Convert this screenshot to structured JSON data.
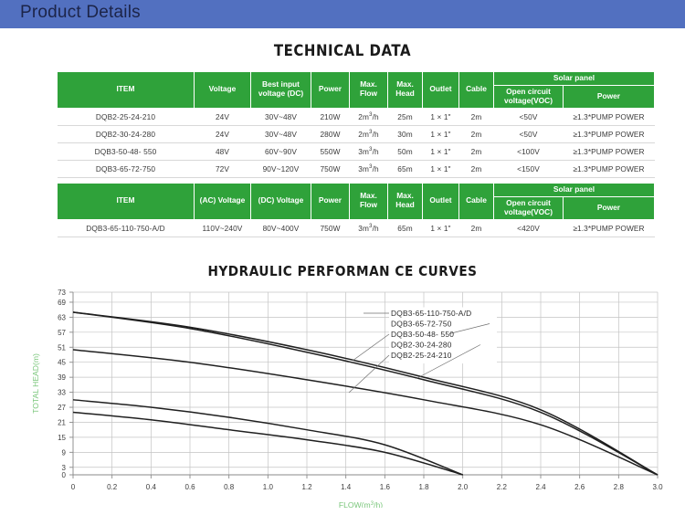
{
  "header": {
    "title": "Product Details",
    "bg_color": "#5270c0",
    "text_color": "#1c2448"
  },
  "theme": {
    "table_header_green": "#2fa23a",
    "axis_label_green": "#79c67a",
    "curve_color": "#1f1f1f",
    "grid_color": "#c4c4c4"
  },
  "tech_data": {
    "title": "TECHNICAL DATA",
    "table_main": {
      "group_header": "Solar panel",
      "columns": [
        "ITEM",
        "Voltage",
        "Best input voltage (DC)",
        "Power",
        "Max. Flow",
        "Max. Head",
        "Outlet",
        "Cable",
        "Open circuit voltage(VOC)",
        "Power"
      ],
      "columns_split": {
        "best_input_line1": "Best input",
        "best_input_line2": "voltage (DC)",
        "max_flow_line1": "Max.",
        "max_flow_line2": "Flow",
        "max_head_line1": "Max.",
        "max_head_line2": "Head",
        "voc_line1": "Open circuit",
        "voc_line2": "voltage(VOC)"
      },
      "rows": [
        {
          "item": "DQB2-25-24-210",
          "voltage": "24V",
          "best_input_voltage": "30V~48V",
          "power": "210W",
          "max_flow_num": "2m",
          "max_flow_sup": "3",
          "max_flow_unit": "/h",
          "max_head": "25m",
          "outlet": "1 × 1\"",
          "cable": "2m",
          "voc": "<50V",
          "solar_power": "≥1.3*PUMP POWER"
        },
        {
          "item": "DQB2-30-24-280",
          "voltage": "24V",
          "best_input_voltage": "30V~48V",
          "power": "280W",
          "max_flow_num": "2m",
          "max_flow_sup": "3",
          "max_flow_unit": "/h",
          "max_head": "30m",
          "outlet": "1 × 1\"",
          "cable": "2m",
          "voc": "<50V",
          "solar_power": "≥1.3*PUMP POWER"
        },
        {
          "item": "DQB3-50-48- 550",
          "voltage": "48V",
          "best_input_voltage": "60V~90V",
          "power": "550W",
          "max_flow_num": "3m",
          "max_flow_sup": "3",
          "max_flow_unit": "/h",
          "max_head": "50m",
          "outlet": "1 × 1\"",
          "cable": "2m",
          "voc": "<100V",
          "solar_power": "≥1.3*PUMP POWER"
        },
        {
          "item": "DQB3-65-72-750",
          "voltage": "72V",
          "best_input_voltage": "90V~120V",
          "power": "750W",
          "max_flow_num": "3m",
          "max_flow_sup": "3",
          "max_flow_unit": "/h",
          "max_head": "65m",
          "outlet": "1 × 1\"",
          "cable": "2m",
          "voc": "<150V",
          "solar_power": "≥1.3*PUMP POWER"
        }
      ]
    },
    "table_ac": {
      "group_header": "Solar panel",
      "columns": [
        "ITEM",
        "(AC) Voltage",
        "(DC) Voltage",
        "Power",
        "Max. Flow",
        "Max. Head",
        "Outlet",
        "Cable",
        "Open circuit voltage(VOC)",
        "Power"
      ],
      "columns_split": {
        "ac_voltage": "(AC) Voltage",
        "dc_voltage": "(DC) Voltage",
        "max_flow_line1": "Max.",
        "max_flow_line2": "Flow",
        "max_head_line1": "Max.",
        "max_head_line2": "Head",
        "voc_line1": "Open circuit",
        "voc_line2": "voltage(VOC)"
      },
      "rows": [
        {
          "item": "DQB3-65-110-750-A/D",
          "ac_voltage": "110V~240V",
          "dc_voltage": "80V~400V",
          "power": "750W",
          "max_flow_num": "3m",
          "max_flow_sup": "3",
          "max_flow_unit": "/h",
          "max_head": "65m",
          "outlet": "1 × 1\"",
          "cable": "2m",
          "voc": "<420V",
          "solar_power": "≥1.3*PUMP POWER"
        }
      ]
    }
  },
  "chart_data": {
    "type": "line",
    "title": "HYDRAULIC PERFORMAN CE CURVES",
    "xlabel": "FLOW(m³/h)",
    "xlabel_parts": {
      "pre": "FLOW(m",
      "sup": "3",
      "post": "/h)"
    },
    "ylabel": "TOTAL HEAD(m)",
    "xlim": [
      0,
      3.0
    ],
    "ylim": [
      0,
      73
    ],
    "xticks": [
      "0",
      "0.2",
      "0.4",
      "0.6",
      "0.8",
      "1.0",
      "1.2",
      "1.4",
      "1.6",
      "1.8",
      "2.0",
      "2.2",
      "2.4",
      "2.6",
      "2.8",
      "3.0"
    ],
    "xtick_values": [
      0,
      0.2,
      0.4,
      0.6,
      0.8,
      1.0,
      1.2,
      1.4,
      1.6,
      1.8,
      2.0,
      2.2,
      2.4,
      2.6,
      2.8,
      3.0
    ],
    "yticks": [
      "0",
      "3",
      "9",
      "15",
      "21",
      "27",
      "33",
      "39",
      "45",
      "51",
      "57",
      "63",
      "69",
      "73"
    ],
    "ytick_values": [
      0,
      3,
      9,
      15,
      21,
      27,
      33,
      39,
      45,
      51,
      57,
      63,
      69,
      73
    ],
    "grid": true,
    "legend_position": "inside-upper-right",
    "series": [
      {
        "name": "DQB3-65-110-750-A/D",
        "points": [
          [
            0,
            65
          ],
          [
            0.6,
            59
          ],
          [
            1.2,
            50
          ],
          [
            1.8,
            39
          ],
          [
            2.4,
            26
          ],
          [
            3.0,
            0
          ]
        ]
      },
      {
        "name": "DQB3-65-72-750",
        "points": [
          [
            0,
            65
          ],
          [
            0.6,
            58.5
          ],
          [
            1.2,
            49
          ],
          [
            1.8,
            38
          ],
          [
            2.4,
            25
          ],
          [
            3.0,
            0
          ]
        ]
      },
      {
        "name": "DQB3-50-48- 550",
        "points": [
          [
            0,
            50
          ],
          [
            0.6,
            45
          ],
          [
            1.2,
            38
          ],
          [
            1.8,
            30
          ],
          [
            2.4,
            20
          ],
          [
            3.0,
            0
          ]
        ]
      },
      {
        "name": "DQB2-30-24-280",
        "points": [
          [
            0,
            30
          ],
          [
            0.4,
            27
          ],
          [
            0.8,
            23
          ],
          [
            1.2,
            18
          ],
          [
            1.6,
            12
          ],
          [
            2.0,
            0
          ]
        ]
      },
      {
        "name": "DQB2-25-24-210",
        "points": [
          [
            0,
            25
          ],
          [
            0.4,
            22
          ],
          [
            0.8,
            18
          ],
          [
            1.2,
            14
          ],
          [
            1.6,
            9
          ],
          [
            2.0,
            0
          ]
        ]
      }
    ]
  }
}
